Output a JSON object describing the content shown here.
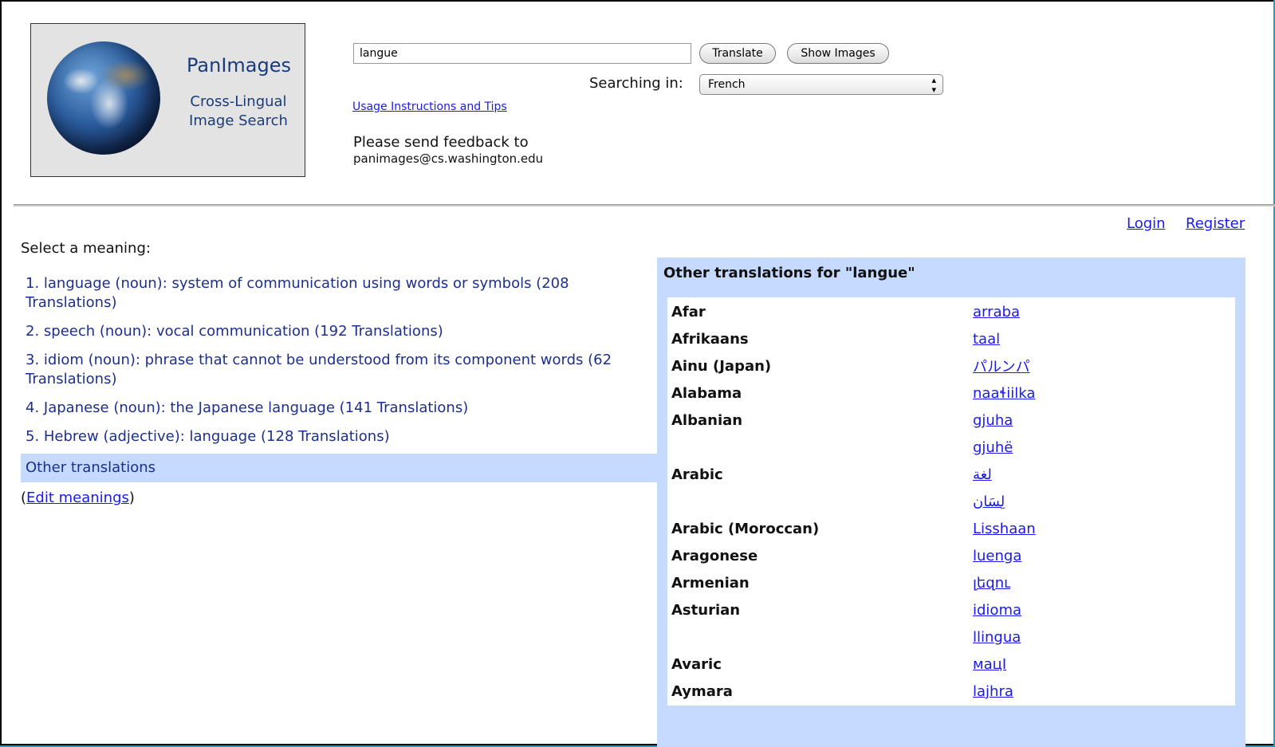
{
  "logo": {
    "title": "PanImages",
    "subtitle": "Cross-Lingual Image Search",
    "image_icon": "earth-globe-icon"
  },
  "search": {
    "value": "langue",
    "translate_button": "Translate",
    "show_images_button": "Show Images",
    "searching_in_label": "Searching in:",
    "language_selected": "French",
    "usage_link": "Usage Instructions and Tips",
    "feedback_line1": "Please send feedback to",
    "feedback_email": "panimages@cs.washington.edu"
  },
  "nav": {
    "login": "Login",
    "register": "Register"
  },
  "meanings": {
    "prompt": "Select a meaning:",
    "items": [
      {
        "label": "1. language (noun): system of communication using words or symbols (208 Translations)"
      },
      {
        "label": "2. speech (noun): vocal communication (192 Translations)"
      },
      {
        "label": "3. idiom (noun): phrase that cannot be understood from its component words (62 Translations)"
      },
      {
        "label": "4. Japanese (noun): the Japanese language (141 Translations)"
      },
      {
        "label": "5. Hebrew (adjective): language (128 Translations)"
      },
      {
        "label": "Other translations",
        "selected": true
      }
    ],
    "edit_open": "(",
    "edit_link": "Edit meanings",
    "edit_close": ")"
  },
  "translations": {
    "title": "Other translations for \"langue\"",
    "rows": [
      {
        "lang": "Afar",
        "word": "arraba"
      },
      {
        "lang": "Afrikaans",
        "word": "taal"
      },
      {
        "lang": "Ainu (Japan)",
        "word": "パルンパ"
      },
      {
        "lang": "Alabama",
        "word": "naaɬiilka"
      },
      {
        "lang": "Albanian",
        "word": "gjuha"
      },
      {
        "lang": "",
        "word": "gjuhë"
      },
      {
        "lang": "Arabic",
        "word": "لغة"
      },
      {
        "lang": "",
        "word": "لِسَان"
      },
      {
        "lang": "Arabic (Moroccan)",
        "word": "Lisshaan"
      },
      {
        "lang": "Aragonese",
        "word": "luenga"
      },
      {
        "lang": "Armenian",
        "word": "լեզու"
      },
      {
        "lang": "Asturian",
        "word": "idioma"
      },
      {
        "lang": "",
        "word": "llingua"
      },
      {
        "lang": "Avaric",
        "word": "мацӀ"
      },
      {
        "lang": "Aymara",
        "word": "lajhra"
      }
    ]
  },
  "colors": {
    "accent_panel": "#c5dafe",
    "link": "#1a1aee",
    "meaning_text": "#1c2f8f",
    "window_frame": "#15a3c3"
  }
}
